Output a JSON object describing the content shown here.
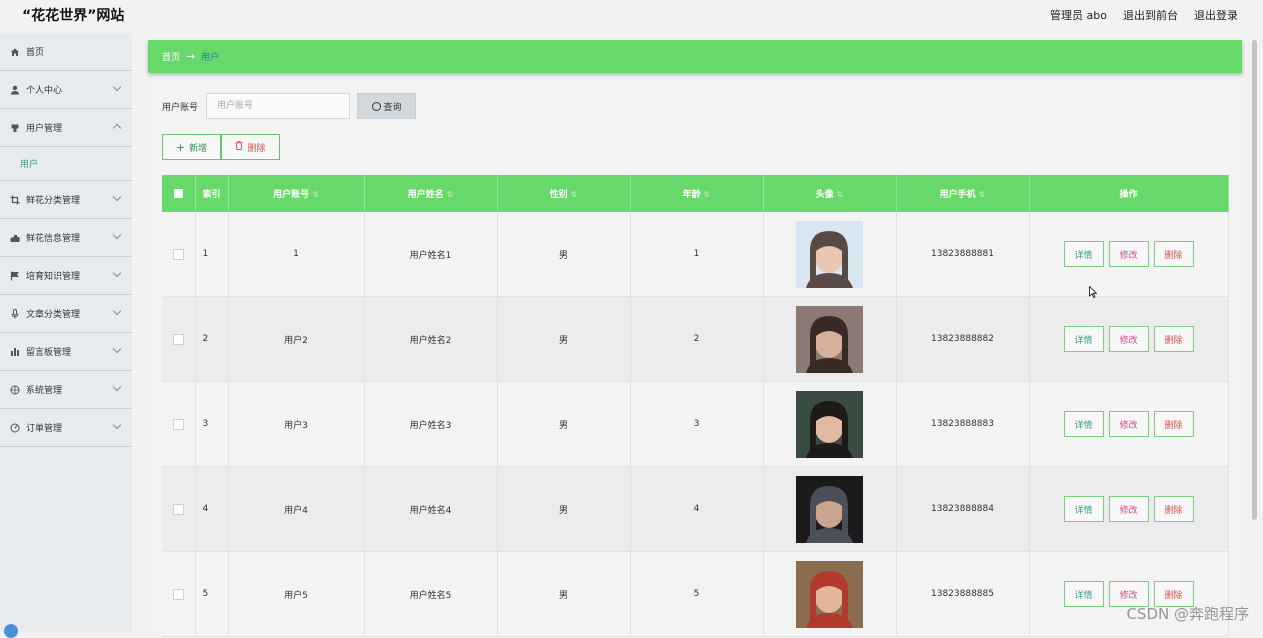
{
  "site_title": "“花花世界”网站",
  "top_links": {
    "admin": "管理员 abo",
    "front": "退出到前台",
    "logout": "退出登录"
  },
  "sidebar": {
    "items": [
      {
        "label": "首页",
        "icon": "home-icon",
        "chevron": false
      },
      {
        "label": "个人中心",
        "icon": "user-icon",
        "chevron": true
      },
      {
        "label": "用户管理",
        "icon": "user-manage-icon",
        "chevron": true,
        "expanded": true
      },
      {
        "label": "鲜花分类管理",
        "icon": "crop-icon",
        "chevron": true
      },
      {
        "label": "鲜花信息管理",
        "icon": "bank-icon",
        "chevron": true
      },
      {
        "label": "培育知识管理",
        "icon": "flag-icon",
        "chevron": true
      },
      {
        "label": "文章分类管理",
        "icon": "microphone-icon",
        "chevron": true
      },
      {
        "label": "留言板管理",
        "icon": "bar-chart-icon",
        "chevron": true
      },
      {
        "label": "系统管理",
        "icon": "compass-icon",
        "chevron": true
      },
      {
        "label": "订单管理",
        "icon": "gauge-icon",
        "chevron": true
      }
    ],
    "submenu": "用户"
  },
  "breadcrumb": {
    "home": "首页",
    "arrow": "→",
    "current": "用户"
  },
  "search": {
    "label": "用户账号",
    "placeholder": "用户账号",
    "button": "查询"
  },
  "actions": {
    "add": "新增",
    "delete": "删除"
  },
  "table": {
    "headers": [
      "索引",
      "用户账号",
      "用户姓名",
      "性别",
      "年龄",
      "头像",
      "用户手机",
      "操作"
    ],
    "rows": [
      {
        "index": "1",
        "account": "1",
        "name": "用户姓名1",
        "gender": "男",
        "age": "1",
        "phone": "13823888881"
      },
      {
        "index": "2",
        "account": "用户2",
        "name": "用户姓名2",
        "gender": "男",
        "age": "2",
        "phone": "13823888882"
      },
      {
        "index": "3",
        "account": "用户3",
        "name": "用户姓名3",
        "gender": "男",
        "age": "3",
        "phone": "13823888883"
      },
      {
        "index": "4",
        "account": "用户4",
        "name": "用户姓名4",
        "gender": "男",
        "age": "4",
        "phone": "13823888884"
      },
      {
        "index": "5",
        "account": "用户5",
        "name": "用户姓名5",
        "gender": "男",
        "age": "5",
        "phone": "13823888885"
      }
    ],
    "row_actions": {
      "detail": "详情",
      "edit": "修改",
      "remove": "删除"
    }
  },
  "watermark": "CSDN @奔跑程序",
  "colors": {
    "accent_green": "#67d86a",
    "sidebar_bg": "#e8ebee",
    "link_teal": "#3b9b8a",
    "danger_red": "#d9534f"
  }
}
